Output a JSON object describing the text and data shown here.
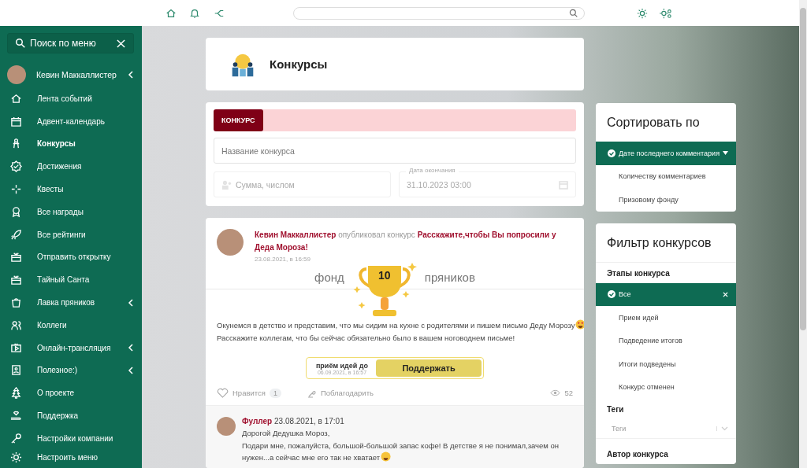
{
  "sidebar": {
    "search_label": "Поиск по меню",
    "user": {
      "name": "Кевин Маккаллистер",
      "has_submenu": true
    },
    "items": [
      {
        "label": "Лента событий",
        "selected": false,
        "has_submenu": false
      },
      {
        "label": "Адвент-календарь",
        "selected": false,
        "has_submenu": false
      },
      {
        "label": "Конкурсы",
        "selected": true,
        "has_submenu": false
      },
      {
        "label": "Достижения",
        "selected": false,
        "has_submenu": false
      },
      {
        "label": "Квесты",
        "selected": false,
        "has_submenu": false
      },
      {
        "label": "Все награды",
        "selected": false,
        "has_submenu": false
      },
      {
        "label": "Все рейтинги",
        "selected": false,
        "has_submenu": false
      },
      {
        "label": "Отправить открытку",
        "selected": false,
        "has_submenu": false
      },
      {
        "label": "Тайный Санта",
        "selected": false,
        "has_submenu": false
      },
      {
        "label": "Лавка пряников",
        "selected": false,
        "has_submenu": true
      },
      {
        "label": "Коллеги",
        "selected": false,
        "has_submenu": false
      },
      {
        "label": "Онлайн-трансляция",
        "selected": false,
        "has_submenu": true
      },
      {
        "label": "Полезное:)",
        "selected": false,
        "has_submenu": true
      },
      {
        "label": "О проекте",
        "selected": false,
        "has_submenu": false
      },
      {
        "label": "Поддержка",
        "selected": false,
        "has_submenu": false
      },
      {
        "label": "Настройки компании",
        "selected": false,
        "has_submenu": false
      },
      {
        "label": "Настроить меню",
        "selected": false,
        "has_submenu": false
      }
    ]
  },
  "page_header": {
    "title": "Конкурсы"
  },
  "form": {
    "tag": "КОНКУРС",
    "name_placeholder": "Название конкурса",
    "amount_placeholder": "Сумма, числом",
    "end_date": {
      "label": "Дата окончания",
      "value": "31.10.2023 03:00",
      "disabled": true
    }
  },
  "post": {
    "author": "Кевин Маккаллистер",
    "action": "опубликовал конкурс",
    "title": "Расскажите,чтобы Вы попросили у Деда Мороза!",
    "time": "23.08.2021, в 16:59",
    "fund_prefix": "фонд",
    "fund_amount": "10",
    "fund_suffix": "пряников",
    "body": [
      "Окунемся в детство и представим, что мы сидим на кухне с родителями и пишем письмо Деду Морозу",
      "Расскажите коллегам, что бы сейчас обязательно было в вашем ноговоднем письме!"
    ],
    "deadline_label": "приём идей до",
    "deadline": "06.09.2021, в 16:57",
    "support_button": "Поддержать",
    "like": {
      "label": "Нравится",
      "count": "1",
      "liked": false
    },
    "thank": "Поблагодарить",
    "views": "52",
    "comment": {
      "author": "Фуллер",
      "time": "23.08.2021, в 17:01",
      "lines": [
        "Дорогой Дедушка Мороз,",
        "Подари мне, пожалуйста, большой-большой запас кофе! В детстве я не понимал,зачем он нужен...а сейчас мне его так не хватает"
      ]
    }
  },
  "sort": {
    "title": "Сортировать по",
    "options": [
      {
        "label": "Дате последнего комментария",
        "selected": true
      },
      {
        "label": "Количеству комментариев",
        "selected": false
      },
      {
        "label": "Призовому фонду",
        "selected": false
      }
    ]
  },
  "filter": {
    "title": "Фильтр конкурсов",
    "stages_label": "Этапы конкурса",
    "stages": [
      {
        "label": "Все",
        "selected": true
      },
      {
        "label": "Прием идей",
        "selected": false
      },
      {
        "label": "Подведение итогов",
        "selected": false
      },
      {
        "label": "Итоги подведены",
        "selected": false
      },
      {
        "label": "Конкурс отменен",
        "selected": false
      }
    ],
    "tags_label": "Теги",
    "tags_placeholder": "Теги",
    "author_label": "Автор конкурса"
  }
}
